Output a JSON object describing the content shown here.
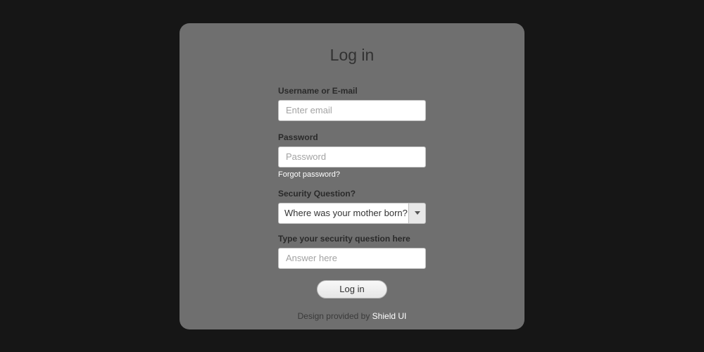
{
  "title": "Log in",
  "username": {
    "label": "Username or E-mail",
    "placeholder": "Enter email"
  },
  "password": {
    "label": "Password",
    "placeholder": "Password"
  },
  "forgot": "Forgot password?",
  "security": {
    "label": "Security Question?",
    "selected": "Where was your mother born?"
  },
  "answer": {
    "label": "Type your security question here",
    "placeholder": "Answer here"
  },
  "login_button": "Log in",
  "footer": {
    "prefix": "Design provided by ",
    "link": "Shield UI"
  }
}
